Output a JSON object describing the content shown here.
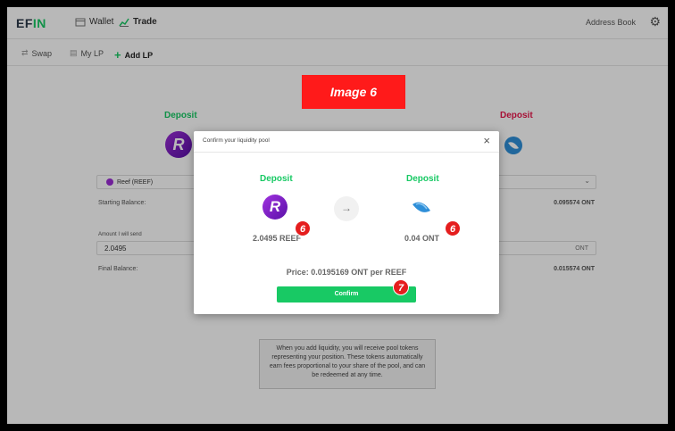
{
  "app": {
    "logo": "EFIN",
    "logo_accent": "IN"
  },
  "topnav": {
    "wallet": "Wallet",
    "trade": "Trade",
    "address_book": "Address Book"
  },
  "subnav": {
    "swap": "Swap",
    "my_lp": "My LP",
    "add_lp": "Add LP"
  },
  "background": {
    "left_deposit": "Deposit",
    "right_deposit": "Deposit",
    "token_select": "Reef (REEF)",
    "starting_balance_label": "Starting Balance:",
    "starting_balance_right": "0.095574 ONT",
    "amount_label": "Amount I will send",
    "amount_value": "2.0495",
    "amount_unit": "ONT",
    "final_balance_label": "Final Balance:",
    "final_balance_right": "0.015574 ONT",
    "info_text": "When you add liquidity, you will receive pool tokens representing your position. These tokens automatically earn fees proportional to your share of the pool, and can be redeemed at any time."
  },
  "banner": {
    "label": "Image 6"
  },
  "modal": {
    "title": "Confirm your liquidity pool",
    "close": "×",
    "left_deposit": "Deposit",
    "right_deposit": "Deposit",
    "left_amount": "2.0495 REEF",
    "right_amount": "0.04 ONT",
    "arrow": "→",
    "price": "Price: 0.0195169 ONT per REEF",
    "confirm": "Confirm"
  },
  "steps": {
    "step_a": "6",
    "step_b": "6",
    "step_c": "7"
  },
  "colors": {
    "green": "#18c964",
    "red": "#e8174b",
    "banner": "#ff1a1a",
    "reef_purple": "#9b2dd6",
    "ont_blue": "#2f8fd8"
  },
  "icons": [
    "wallet-icon",
    "trade-icon",
    "gear-icon",
    "swap-icon",
    "mylp-icon",
    "plus-icon",
    "reef-icon",
    "ont-icon",
    "arrow-right-icon",
    "close-icon",
    "chevron-down-icon"
  ]
}
